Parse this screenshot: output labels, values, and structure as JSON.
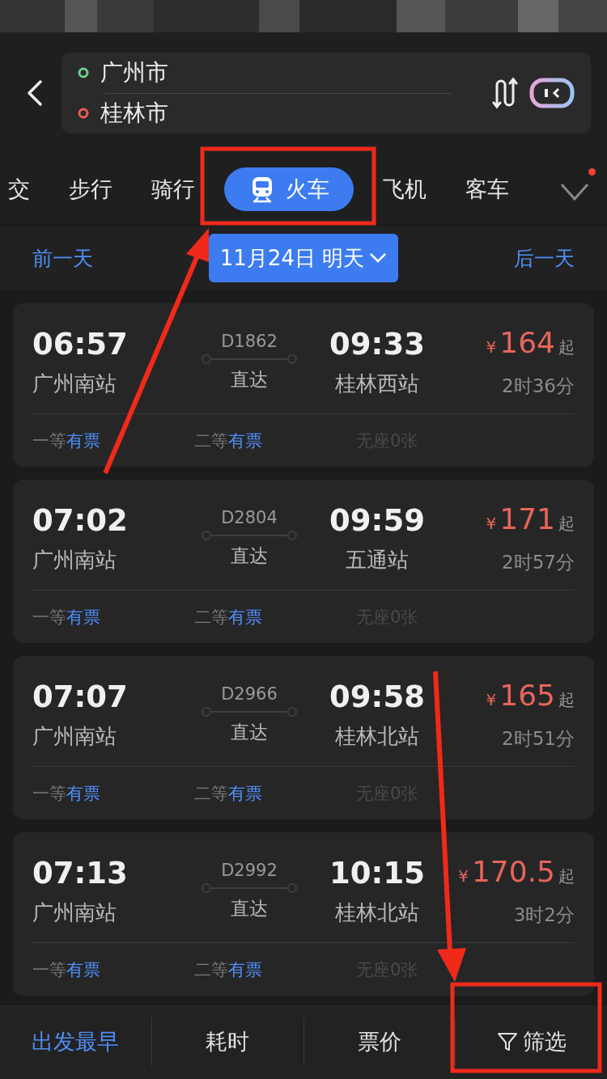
{
  "route": {
    "from": "广州市",
    "to": "桂林市"
  },
  "modes": [
    {
      "label": "交",
      "selected": false
    },
    {
      "label": "步行",
      "selected": false
    },
    {
      "label": "骑行",
      "selected": false
    },
    {
      "label": "火车",
      "selected": true
    },
    {
      "label": "飞机",
      "selected": false
    },
    {
      "label": "客车",
      "selected": false
    }
  ],
  "date_bar": {
    "prev": "前一天",
    "date": "11月24日 明天",
    "next": "后一天"
  },
  "trains": [
    {
      "depart": "06:57",
      "from": "广州南站",
      "number": "D1862",
      "type": "直达",
      "arrive": "09:33",
      "to": "桂林西站",
      "currency": "¥",
      "price": "164",
      "suffix": "起",
      "duration": "2时36分",
      "seats": [
        {
          "class": "一等",
          "status": "有票",
          "available": true
        },
        {
          "class": "二等",
          "status": "有票",
          "available": true
        },
        {
          "class": "无座",
          "status": "0张",
          "available": false
        }
      ]
    },
    {
      "depart": "07:02",
      "from": "广州南站",
      "number": "D2804",
      "type": "直达",
      "arrive": "09:59",
      "to": "五通站",
      "currency": "¥",
      "price": "171",
      "suffix": "起",
      "duration": "2时57分",
      "seats": [
        {
          "class": "一等",
          "status": "有票",
          "available": true
        },
        {
          "class": "二等",
          "status": "有票",
          "available": true
        },
        {
          "class": "无座",
          "status": "0张",
          "available": false
        }
      ]
    },
    {
      "depart": "07:07",
      "from": "广州南站",
      "number": "D2966",
      "type": "直达",
      "arrive": "09:58",
      "to": "桂林北站",
      "currency": "¥",
      "price": "165",
      "suffix": "起",
      "duration": "2时51分",
      "seats": [
        {
          "class": "一等",
          "status": "有票",
          "available": true
        },
        {
          "class": "二等",
          "status": "有票",
          "available": true
        },
        {
          "class": "无座",
          "status": "0张",
          "available": false
        }
      ]
    },
    {
      "depart": "07:13",
      "from": "广州南站",
      "number": "D2992",
      "type": "直达",
      "arrive": "10:15",
      "to": "桂林北站",
      "currency": "¥",
      "price": "170.5",
      "suffix": "起",
      "duration": "3时2分",
      "seats": [
        {
          "class": "一等",
          "status": "有票",
          "available": true
        },
        {
          "class": "二等",
          "status": "有票",
          "available": true
        },
        {
          "class": "无座",
          "status": "0张",
          "available": false
        }
      ]
    }
  ],
  "sort_bar": [
    {
      "label": "出发最早",
      "kind": "sort",
      "selected": true
    },
    {
      "label": "耗时",
      "kind": "sort",
      "selected": false
    },
    {
      "label": "票价",
      "kind": "sort",
      "selected": false
    },
    {
      "label": "筛选",
      "kind": "filter",
      "selected": false
    }
  ]
}
